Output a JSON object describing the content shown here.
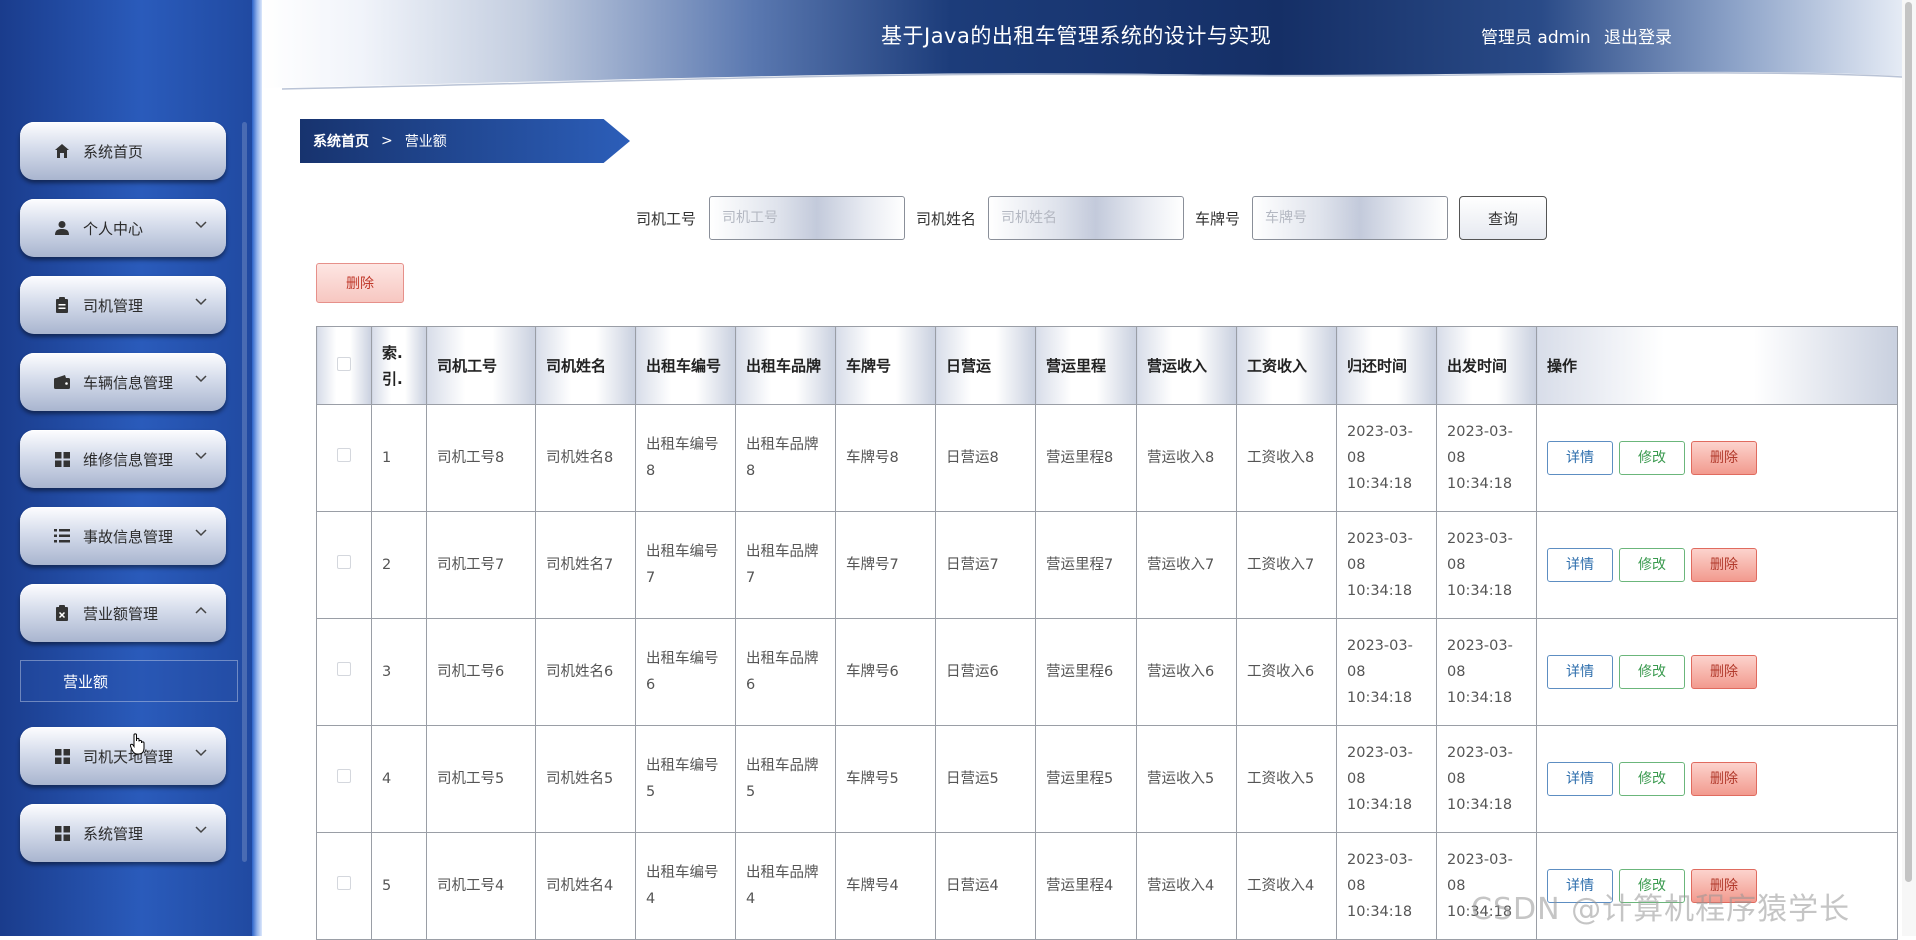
{
  "header": {
    "title": "基于Java的出租车管理系统的设计与实现",
    "user": "管理员 admin",
    "logout": "退出登录"
  },
  "sidebar": {
    "items": [
      {
        "label": "系统首页",
        "icon": "home-icon",
        "expandable": false
      },
      {
        "label": "个人中心",
        "icon": "user-icon",
        "expandable": true
      },
      {
        "label": "司机管理",
        "icon": "clipboard-icon",
        "expandable": true
      },
      {
        "label": "车辆信息管理",
        "icon": "wallet-icon",
        "expandable": true
      },
      {
        "label": "维修信息管理",
        "icon": "grid-icon",
        "expandable": true
      },
      {
        "label": "事故信息管理",
        "icon": "list-icon",
        "expandable": true
      },
      {
        "label": "营业额管理",
        "icon": "clipboard-x-icon",
        "expandable": true,
        "expanded": true
      },
      {
        "label": "司机天地管理",
        "icon": "grid-icon",
        "expandable": true
      },
      {
        "label": "系统管理",
        "icon": "grid-icon",
        "expandable": true
      }
    ],
    "submenu_item": "营业额"
  },
  "breadcrumb": {
    "home": "系统首页",
    "separator": ">",
    "current": "营业额"
  },
  "search": {
    "driver_id_label": "司机工号",
    "driver_id_placeholder": "司机工号",
    "driver_name_label": "司机姓名",
    "driver_name_placeholder": "司机姓名",
    "plate_label": "车牌号",
    "plate_placeholder": "车牌号",
    "query_button": "查询"
  },
  "delete_button": "删除",
  "table": {
    "headers": [
      "索.引.",
      "司机工号",
      "司机姓名",
      "出租车编号",
      "出租车品牌",
      "车牌号",
      "日营运",
      "营运里程",
      "营运收入",
      "工资收入",
      "归还时间",
      "出发时间",
      "操作"
    ],
    "rows": [
      [
        "1",
        "司机工号8",
        "司机姓名8",
        "出租车编号8",
        "出租车品牌8",
        "车牌号8",
        "日营运8",
        "营运里程8",
        "营运收入8",
        "工资收入8",
        "2023-03-08 10:34:18",
        "2023-03-08 10:34:18"
      ],
      [
        "2",
        "司机工号7",
        "司机姓名7",
        "出租车编号7",
        "出租车品牌7",
        "车牌号7",
        "日营运7",
        "营运里程7",
        "营运收入7",
        "工资收入7",
        "2023-03-08 10:34:18",
        "2023-03-08 10:34:18"
      ],
      [
        "3",
        "司机工号6",
        "司机姓名6",
        "出租车编号6",
        "出租车品牌6",
        "车牌号6",
        "日营运6",
        "营运里程6",
        "营运收入6",
        "工资收入6",
        "2023-03-08 10:34:18",
        "2023-03-08 10:34:18"
      ],
      [
        "4",
        "司机工号5",
        "司机姓名5",
        "出租车编号5",
        "出租车品牌5",
        "车牌号5",
        "日营运5",
        "营运里程5",
        "营运收入5",
        "工资收入5",
        "2023-03-08 10:34:18",
        "2023-03-08 10:34:18"
      ],
      [
        "5",
        "司机工号4",
        "司机姓名4",
        "出租车编号4",
        "出租车品牌4",
        "车牌号4",
        "日营运4",
        "营运里程4",
        "营运收入4",
        "工资收入4",
        "2023-03-08 10:34:18",
        "2023-03-08 10:34:18"
      ]
    ],
    "actions": {
      "detail": "详情",
      "edit": "修改",
      "delete": "删除"
    }
  },
  "watermark": "CSDN @计算机程序猿学长",
  "colors": {
    "sidebar_blue": "#2a5bbb",
    "header_navy": "#152f66",
    "delete_red": "#f29a8e",
    "edit_green": "#3a9a4f",
    "detail_blue": "#2f6fad"
  }
}
